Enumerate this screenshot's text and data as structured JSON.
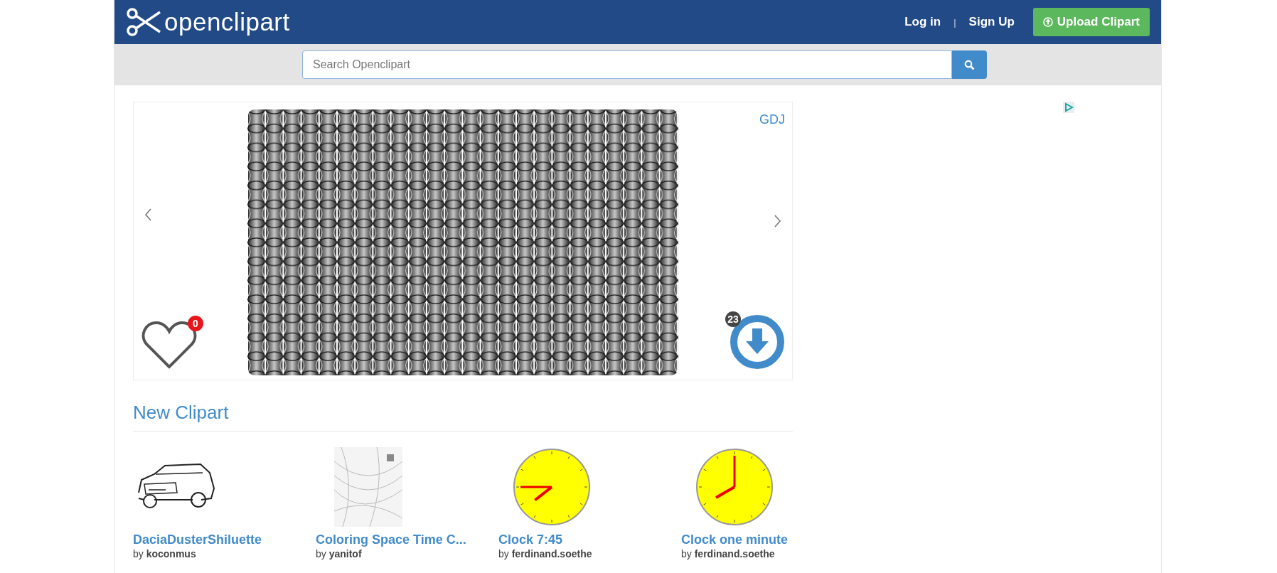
{
  "header": {
    "logo": "openclipart",
    "links": [
      {
        "label": "Log in"
      },
      {
        "label": "Sign Up"
      }
    ],
    "separator": "|",
    "upload_button": "Upload Clipart"
  },
  "search": {
    "placeholder": "Search Openclipart"
  },
  "featured": {
    "author": "GDJ",
    "likes": "0",
    "downloads": "23"
  },
  "new_clipart": {
    "title": "New Clipart",
    "items": [
      {
        "kind": "car",
        "title": "DaciaDusterShiluette",
        "author": "by **koconmus**"
      },
      {
        "kind": "sketch",
        "title": "Coloring Space Time C...",
        "author": "by **yanitof**"
      },
      {
        "kind": "clock",
        "title": "Clock 7:45",
        "author": "by **ferdinand.soethe**"
      },
      {
        "kind": "clock",
        "title": "Clock one minute",
        "author": "by **ferdinand.soethe**"
      }
    ]
  }
}
